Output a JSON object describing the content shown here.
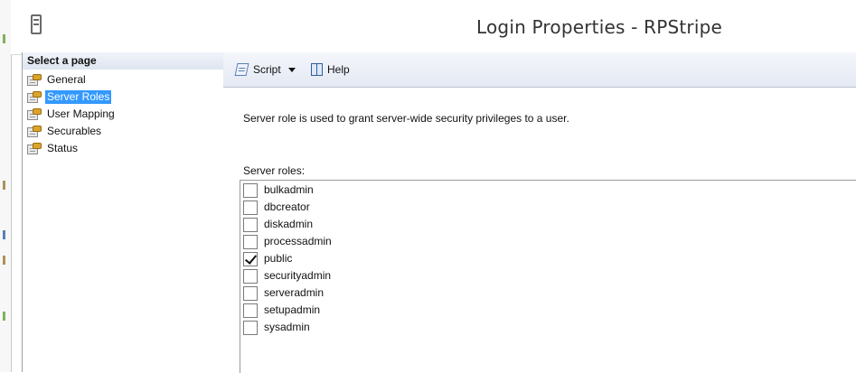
{
  "window": {
    "title": "Login Properties - RPStripe"
  },
  "page_selector": {
    "header": "Select a page",
    "items": [
      {
        "label": "General",
        "selected": false
      },
      {
        "label": "Server Roles",
        "selected": true
      },
      {
        "label": "User Mapping",
        "selected": false
      },
      {
        "label": "Securables",
        "selected": false
      },
      {
        "label": "Status",
        "selected": false
      }
    ]
  },
  "toolbar": {
    "script_label": "Script",
    "help_label": "Help"
  },
  "content": {
    "description": "Server role is used to grant server-wide security privileges to a user.",
    "roles_label": "Server roles:",
    "roles": [
      {
        "name": "bulkadmin",
        "checked": false
      },
      {
        "name": "dbcreator",
        "checked": false
      },
      {
        "name": "diskadmin",
        "checked": false
      },
      {
        "name": "processadmin",
        "checked": false
      },
      {
        "name": "public",
        "checked": true
      },
      {
        "name": "securityadmin",
        "checked": false
      },
      {
        "name": "serveradmin",
        "checked": false
      },
      {
        "name": "setupadmin",
        "checked": false
      },
      {
        "name": "sysadmin",
        "checked": false
      }
    ]
  },
  "colors": {
    "selection": "#3399ff",
    "toolbar_top": "#f4f6fb",
    "toolbar_bottom": "#e4e9f3"
  }
}
